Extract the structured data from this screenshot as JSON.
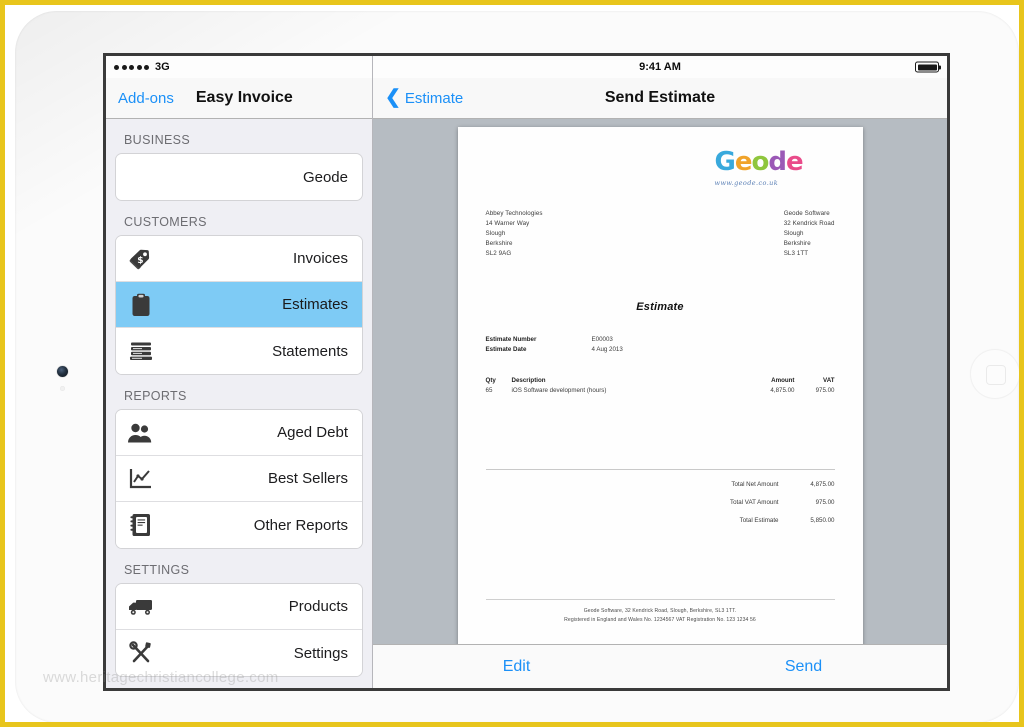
{
  "device": {
    "type": "tablet",
    "frame_color": "#e8c51c",
    "body_color": "#fbfbfb"
  },
  "watermark": "www.heritagechristiancollege.com",
  "sidebar": {
    "status_bar": {
      "carrier": "3G",
      "signal_dots": 5
    },
    "addons_label": "Add-ons",
    "title": "Easy Invoice",
    "groups": [
      {
        "header": "BUSINESS",
        "items": [
          {
            "label": "Geode",
            "icon": "",
            "selected": false
          }
        ]
      },
      {
        "header": "CUSTOMERS",
        "items": [
          {
            "label": "Invoices",
            "icon": "price-tag-icon",
            "selected": false
          },
          {
            "label": "Estimates",
            "icon": "clipboard-icon",
            "selected": true
          },
          {
            "label": "Statements",
            "icon": "stacked-papers-icon",
            "selected": false
          }
        ]
      },
      {
        "header": "REPORTS",
        "items": [
          {
            "label": "Aged Debt",
            "icon": "people-icon",
            "selected": false
          },
          {
            "label": "Best Sellers",
            "icon": "line-chart-icon",
            "selected": false
          },
          {
            "label": "Other Reports",
            "icon": "notebook-icon",
            "selected": false
          }
        ]
      },
      {
        "header": "SETTINGS",
        "items": [
          {
            "label": "Products",
            "icon": "truck-icon",
            "selected": false
          },
          {
            "label": "Settings",
            "icon": "tools-icon",
            "selected": false
          }
        ]
      }
    ],
    "selected_color": "#7ecbf5",
    "accent_color": "#1b90f7"
  },
  "detail": {
    "status_bar": {
      "time": "9:41 AM",
      "battery": "full"
    },
    "back_label": "Estimate",
    "title": "Send Estimate",
    "toolbar": {
      "edit_label": "Edit",
      "send_label": "Send"
    }
  },
  "document": {
    "logo": {
      "word": "Geode",
      "letters": [
        {
          "char": "G",
          "color": "#39a9dc"
        },
        {
          "char": "e",
          "color": "#f0a32a"
        },
        {
          "char": "o",
          "color": "#8fc63d"
        },
        {
          "char": "d",
          "color": "#9b59b6"
        },
        {
          "char": "e",
          "color": "#e94b8a"
        }
      ],
      "url": "www.geode.co.uk"
    },
    "customer_address": [
      "Abbey Technologies",
      "14 Warner Way",
      "Slough",
      "Berkshire",
      "SL2 9AG"
    ],
    "company_address": [
      "Geode Software",
      "32 Kendrick Road",
      "Slough",
      "Berkshire",
      "SL3 1TT"
    ],
    "doc_type": "Estimate",
    "meta": [
      {
        "key": "Estimate Number",
        "value": "E00003"
      },
      {
        "key": "Estimate Date",
        "value": "4 Aug 2013"
      }
    ],
    "items_header": {
      "qty": "Qty",
      "description": "Description",
      "amount": "Amount",
      "vat": "VAT"
    },
    "items": [
      {
        "qty": "65",
        "description": "iOS Software development (hours)",
        "amount": "4,875.00",
        "vat": "975.00"
      }
    ],
    "totals": [
      {
        "label": "Total Net Amount",
        "value": "4,875.00"
      },
      {
        "label": "Total VAT Amount",
        "value": "975.00"
      },
      {
        "label": "Total Estimate",
        "value": "5,850.00"
      }
    ],
    "footer_lines": [
      "Geode Software, 32 Kendrick Road, Slough, Berkshire, SL3 1TT.",
      "Registered in England and Wales No. 1234567    VAT Registration No. 123 1234 56"
    ]
  }
}
